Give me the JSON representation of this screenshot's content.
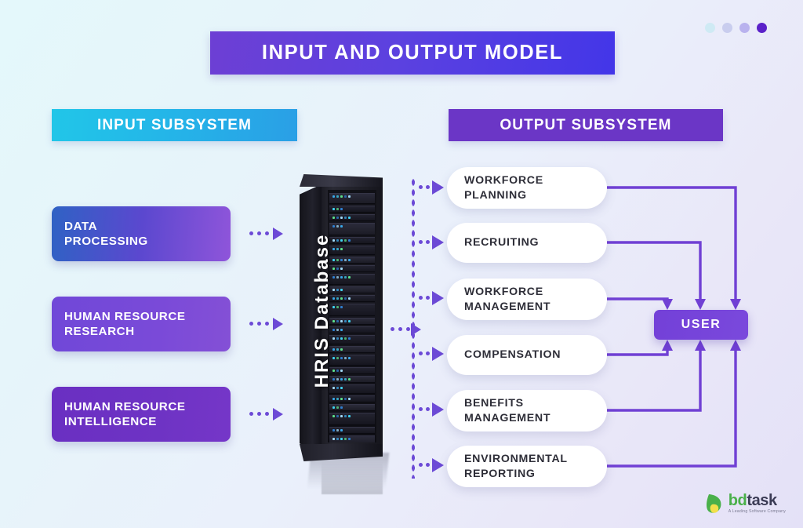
{
  "page": {
    "title": "INPUT AND OUTPUT MODEL",
    "background_from": "#e4f8fb",
    "background_to": "#e4e1f7",
    "accent_purple": "#6c4ad6"
  },
  "decor_dots": [
    {
      "name": "dot-1",
      "color": "#cfeaf4"
    },
    {
      "name": "dot-2",
      "color": "#c9cdee"
    },
    {
      "name": "dot-3",
      "color": "#b9b2ee"
    },
    {
      "name": "dot-4",
      "color": "#5b21c9"
    }
  ],
  "input_section": {
    "header": "INPUT SUBSYSTEM",
    "header_color": "#22bfe7",
    "items": [
      {
        "line1": "DATA",
        "line2": "PROCESSING",
        "color": "#2f62c4"
      },
      {
        "line1": "HUMAN RESOURCE",
        "line2": "RESEARCH",
        "color": "#7048d8"
      },
      {
        "line1": "HUMAN RESOURCE",
        "line2": "INTELLIGENCE",
        "color": "#6a2fc2"
      }
    ]
  },
  "database": {
    "label": "HRIS Database"
  },
  "output_section": {
    "header": "OUTPUT SUBSYSTEM",
    "header_color": "#6b36c6",
    "items": [
      {
        "line1": "WORKFORCE",
        "line2": "PLANNING"
      },
      {
        "line1": "RECRUITING",
        "line2": ""
      },
      {
        "line1": "WORKFORCE",
        "line2": "MANAGEMENT"
      },
      {
        "line1": "COMPENSATION",
        "line2": ""
      },
      {
        "line1": "BENEFITS",
        "line2": "MANAGEMENT"
      },
      {
        "line1": "ENVIRONMENTAL",
        "line2": "REPORTING"
      }
    ]
  },
  "user_node": {
    "label": "USER",
    "color": "#7340d8"
  },
  "logo": {
    "name_bd": "bd",
    "name_task": "task",
    "tagline": "A Leading Software Company"
  }
}
